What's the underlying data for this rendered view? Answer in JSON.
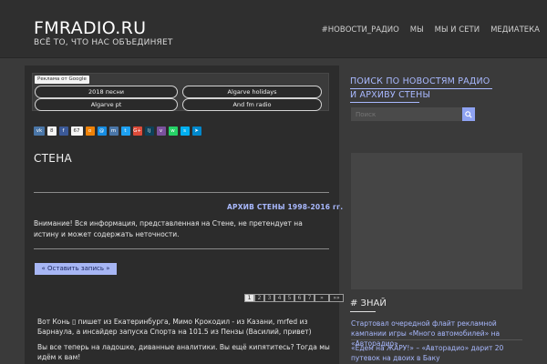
{
  "header": {
    "site_title": "FMRADIO.RU",
    "site_desc": "ВСЁ ТО, ЧТО НАС ОБЪЕДИНЯЕТ",
    "nav": [
      "#НОВОСТИ_РАДИО",
      "МЫ",
      "МЫ и СЕТИ",
      "МЕДИАТЕКА"
    ]
  },
  "ad": {
    "label": "Реклама от Google",
    "links": [
      "2018 песни",
      "Algarve holidays",
      "Algarve pt",
      "And fm radio"
    ]
  },
  "share": {
    "vk_count": "8",
    "fb_count": "67",
    "buttons": [
      "vk",
      "facebook",
      "odnoklassniki",
      "mail",
      "twitter",
      "google-plus",
      "livejournal",
      "viber",
      "whatsapp",
      "skype",
      "telegram"
    ],
    "colors": {
      "vk": "#4a76a8",
      "facebook": "#3b5998",
      "odnoklassniki": "#ee8208",
      "mail": "#168de2",
      "twitter": "#1da1f2",
      "google-plus": "#dd4b39",
      "livejournal": "#0d425a",
      "viber": "#7b519d",
      "whatsapp": "#25d366",
      "skype": "#00aff0",
      "telegram": "#0088cc"
    }
  },
  "page": {
    "title": "СТЕНА",
    "archive_link": "АРХИВ СТЕНЫ 1998-2016 гг.",
    "notice": "Внимание! Вся информация, представленная на Стене, не претендует на истину и может содержать неточности.",
    "post_button": "« Оставить запись »",
    "pager": [
      "1",
      "2",
      "3",
      "4",
      "5",
      "6",
      "7",
      "»",
      "»»"
    ],
    "messages": [
      "Вот Конь ▯ пишет из Екатеринбурга, Мимо Крокодил - из Казани, mrfed из Барнаула, а инсайдер запуска Спорта на 101.5 из Пензы (Василий, привет)",
      "Вы все теперь на ладошке, диванные аналитики. Вы ещё кипятитесь? Тогда мы идём к вам!"
    ]
  },
  "sidebar": {
    "search_title": "ПОИСК ПО НОВОСТЯМ РАДИО И АРХИВУ СТЕНЫ",
    "search_placeholder": "Поиск",
    "znai_title": "# ЗНАЙ",
    "news": [
      "Стартовал очередной флайт рекламной кампании игры «Много автомобилей» на «Авторадио»",
      "«Едем на ЖАРУ!» – «Авторадио» дарит 20 путевок на двоих в Баку"
    ]
  },
  "colors": {
    "accent": "#a9b9ff",
    "button": "#a7b6f4",
    "background": "#3a3a3a",
    "panel": "#2c2c2c"
  }
}
